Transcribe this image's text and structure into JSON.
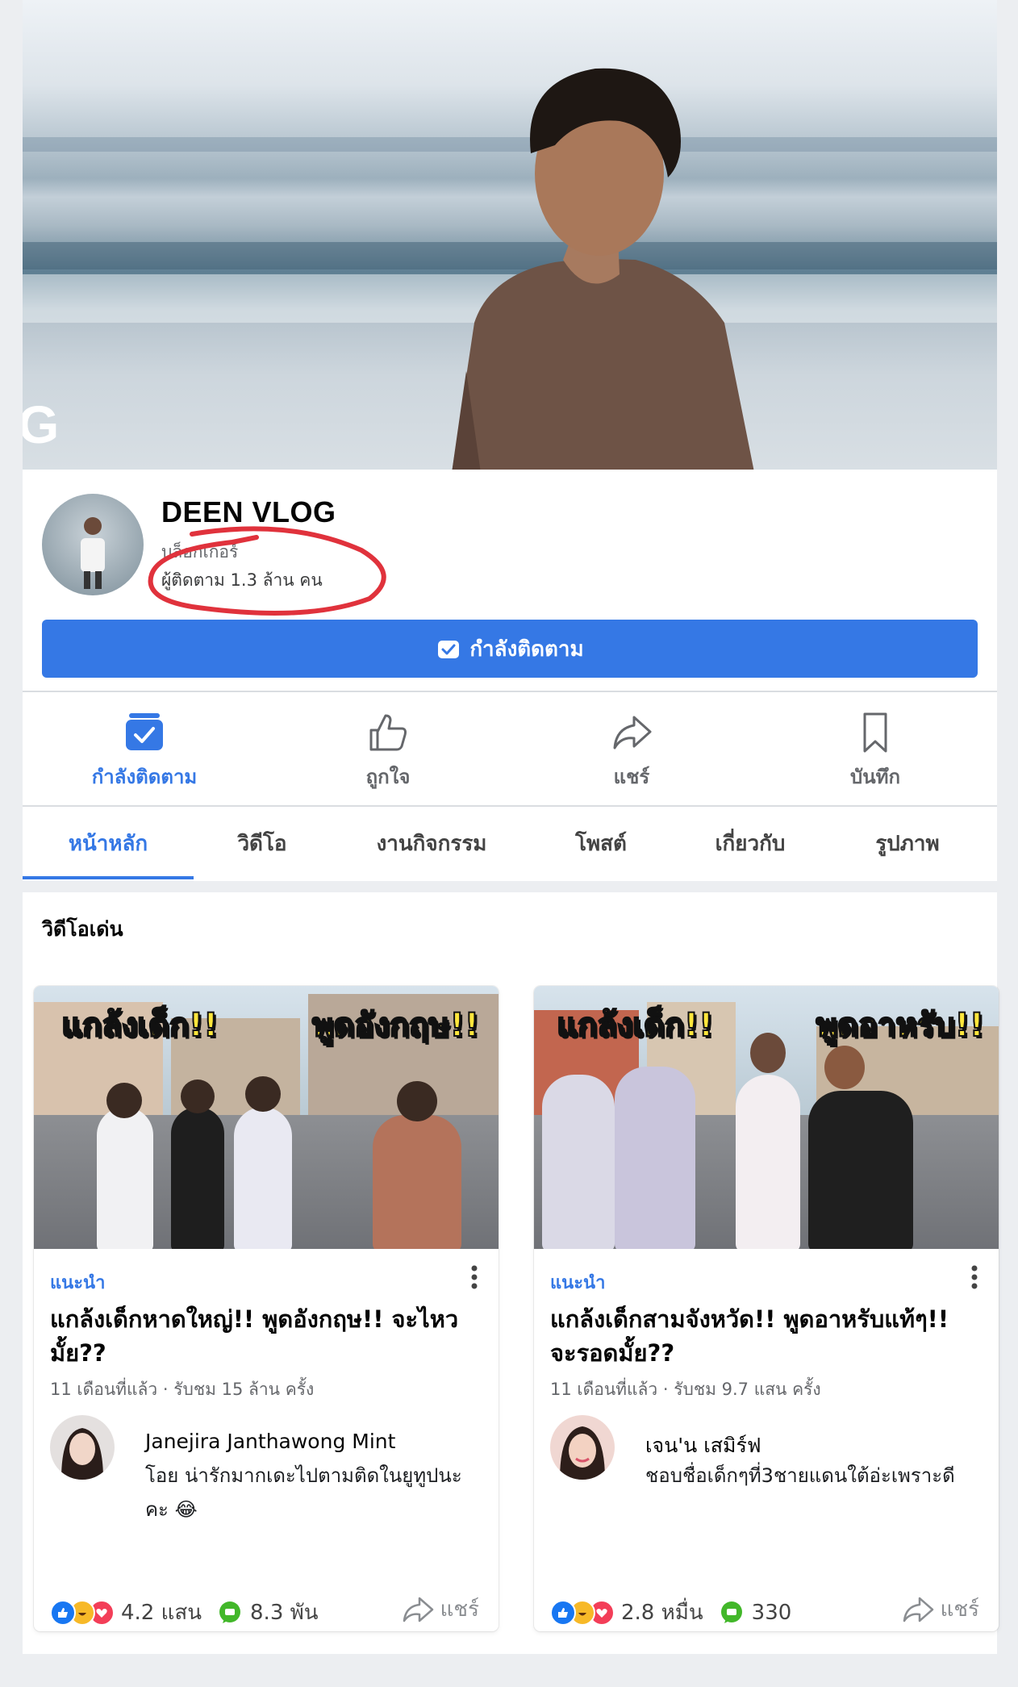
{
  "cover": {
    "overlay_letter": "G"
  },
  "profile": {
    "name": "DEEN VLOG",
    "category": "บล็อกเกอร์",
    "followers": "ผู้ติดตาม 1.3 ล้าน คน",
    "follow_button": "กำลังติดตาม"
  },
  "actions": [
    {
      "label": "กำลังติดตาม",
      "icon": "following-icon",
      "active": true
    },
    {
      "label": "ถูกใจ",
      "icon": "like-icon"
    },
    {
      "label": "แชร์",
      "icon": "share-icon"
    },
    {
      "label": "บันทึก",
      "icon": "bookmark-icon"
    }
  ],
  "tabs": [
    "หน้าหลัก",
    "วิดีโอ",
    "งานกิจกรรม",
    "โพสต์",
    "เกี่ยวกับ",
    "รูปภาพ"
  ],
  "section_title": "วิดีโอเด่น",
  "videos": [
    {
      "overlay_left": "แกล้งเด็ก!!",
      "overlay_right": "พูดอังกฤษ!!",
      "tag": "แนะนำ",
      "title": "แกล้งเด็กหาดใหญ่!! พูดอังกฤษ!! จะไหวมั้ย??",
      "meta": "11 เดือนที่แล้ว · รับชม 15 ล้าน ครั้ง",
      "commenter": "Janejira Janthawong Mint",
      "comment": "โอย น่ารักมากเดะไปตามติดในยูทูปนะคะ 😂",
      "reaction_count": "4.2 แสน",
      "comment_count": "8.3 พัน",
      "share_label": "แชร์"
    },
    {
      "overlay_left": "แกล้งเด็ก!!",
      "overlay_right": "พูดอาหรับ!!",
      "tag": "แนะนำ",
      "title": "แกล้งเด็กสามจังหวัด!! พูดอาหรับแท้ๆ!! จะรอดมั้ย??",
      "meta": "11 เดือนที่แล้ว · รับชม 9.7 แสน ครั้ง",
      "commenter": "เจน'น เสมิร์ฟ",
      "comment": "ชอบชื่อเด็กๆที่3ชายแดนใต้อ่ะเพราะดี",
      "reaction_count": "2.8 หมื่น",
      "comment_count": "330",
      "share_label": "แชร์"
    }
  ],
  "colors": {
    "accent": "#3578e5",
    "annotation": "#e0323c"
  }
}
